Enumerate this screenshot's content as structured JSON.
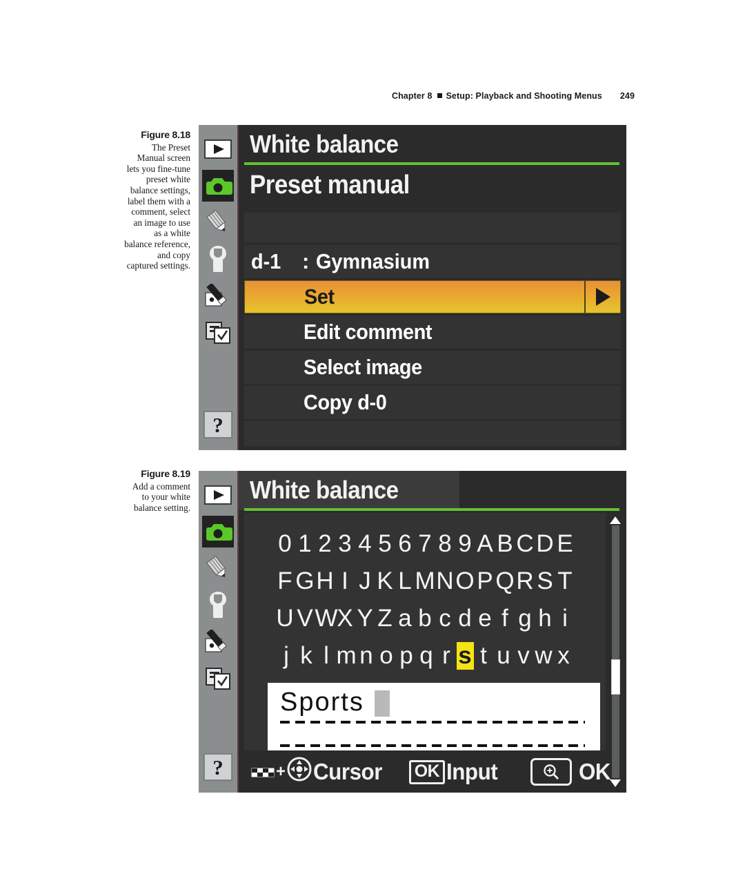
{
  "running_head": {
    "chapter": "Chapter 8",
    "title": "Setup: Playback and Shooting Menus",
    "page": "249"
  },
  "figures": [
    {
      "id": "8.18",
      "label": "Figure 8.18",
      "caption": "The Preset Manual screen lets you fine-tune preset white balance settings, label them with a comment, select an image to use as a white balance reference, and copy captured settings."
    },
    {
      "id": "8.19",
      "label": "Figure 8.19",
      "caption": "Add a comment to your white balance setting."
    }
  ],
  "sidebar": {
    "items": [
      {
        "name": "playback-menu",
        "icon": "play-icon",
        "active": false
      },
      {
        "name": "shooting-menu",
        "icon": "camera-icon",
        "active": true
      },
      {
        "name": "custom-settings-menu",
        "icon": "pencil-icon",
        "active": false
      },
      {
        "name": "setup-menu",
        "icon": "wrench-icon",
        "active": false
      },
      {
        "name": "retouch-menu",
        "icon": "paintbrush-icon",
        "active": false
      },
      {
        "name": "recent-settings-menu",
        "icon": "checklist-icon",
        "active": false
      },
      {
        "name": "help",
        "icon": "question-mark-icon",
        "active": false
      }
    ]
  },
  "screen_preset_manual": {
    "title": "White balance",
    "subtitle": "Preset manual",
    "preset": {
      "id": "d-1",
      "separator": ":",
      "name": "Gymnasium"
    },
    "menu_items": [
      {
        "label": "Set",
        "selected": true,
        "has_arrow": true
      },
      {
        "label": "Edit comment",
        "selected": false,
        "has_arrow": false
      },
      {
        "label": "Select image",
        "selected": false,
        "has_arrow": false
      },
      {
        "label": "Copy d-0",
        "selected": false,
        "has_arrow": false
      }
    ],
    "accent_color": "#63c132",
    "highlight_color": "#e9a72f"
  },
  "screen_comment": {
    "title": "White balance",
    "keyboard_rows": [
      [
        "0",
        "1",
        "2",
        "3",
        "4",
        "5",
        "6",
        "7",
        "8",
        "9",
        "A",
        "B",
        "C",
        "D",
        "E"
      ],
      [
        "F",
        "G",
        "H",
        "I",
        "J",
        "K",
        "L",
        "M",
        "N",
        "O",
        "P",
        "Q",
        "R",
        "S",
        "T"
      ],
      [
        "U",
        "V",
        "W",
        "X",
        "Y",
        "Z",
        "a",
        "b",
        "c",
        "d",
        "e",
        "f",
        "g",
        "h",
        "i"
      ],
      [
        "j",
        "k",
        "l",
        "m",
        "n",
        "o",
        "p",
        "q",
        "r",
        "s",
        "t",
        "u",
        "v",
        "w",
        "x"
      ]
    ],
    "selected_key": "s",
    "selected_key_row": 3,
    "selected_key_col": 9,
    "highlight_color": "#f4e414",
    "text_field_value": "Sports",
    "status_bar": [
      {
        "icon": "thumbnail-button-icon",
        "plus": "+",
        "icon2": "multi-selector-icon",
        "label": "Cursor"
      },
      {
        "chip": "OK",
        "label": "Input"
      },
      {
        "icon": "magnify-plus-icon",
        "label": "OK"
      }
    ],
    "accent_color": "#63c132"
  }
}
